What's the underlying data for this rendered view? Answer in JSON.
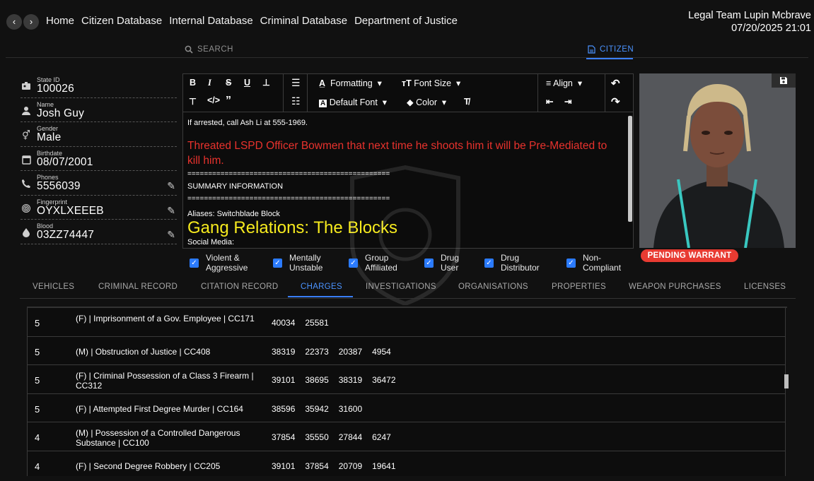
{
  "nav": {
    "back_icon": "chevron-left-icon",
    "forward_icon": "chevron-right-icon",
    "links": [
      "Home",
      "Citizen Database",
      "Internal Database",
      "Criminal Database",
      "Department of Justice"
    ]
  },
  "user": {
    "name": "Legal Team Lupin Mcbrave",
    "datetime": "07/20/2025 21:01"
  },
  "modes": {
    "search": "SEARCH",
    "citizen": "CITIZEN"
  },
  "profile": {
    "state_id": {
      "label": "State ID",
      "value": "100026"
    },
    "name": {
      "label": "Name",
      "value": "Josh Guy"
    },
    "gender": {
      "label": "Gender",
      "value": "Male"
    },
    "birthdate": {
      "label": "Birthdate",
      "value": "08/07/2001"
    },
    "phones": {
      "label": "Phones",
      "value": "5556039"
    },
    "fingerprint": {
      "label": "Fingerprint",
      "value": "OYXLXEEEB"
    },
    "blood": {
      "label": "Blood",
      "value": "03ZZ74447"
    }
  },
  "toolbar": {
    "formatting": "Formatting",
    "font_size": "Font Size",
    "default_font": "Default Font",
    "color": "Color",
    "align": "Align"
  },
  "notes": {
    "line1": "If arrested, call Ash Li at 555-1969.",
    "threat": "Threated LSPD Officer Bowmen that next time he shoots him it will be Pre-Mediated to kill him.",
    "sep": "=================================================",
    "summary": "SUMMARY INFORMATION",
    "aliases": "Aliases: Switchblade Block",
    "gang": "Gang Relations: The Blocks",
    "social": "Social Media:"
  },
  "status_badge": "PENDING WARRANT",
  "flags": [
    {
      "line1": "Violent &",
      "line2": "Aggressive",
      "checked": true
    },
    {
      "line1": "Mentally",
      "line2": "Unstable",
      "checked": true
    },
    {
      "line1": "Group",
      "line2": "Affiliated",
      "checked": true
    },
    {
      "line1": "Drug",
      "line2": "User",
      "checked": true
    },
    {
      "line1": "Drug",
      "line2": "Distributor",
      "checked": true
    },
    {
      "line1": "Non-",
      "line2": "Compliant",
      "checked": true
    }
  ],
  "tabs": [
    "VEHICLES",
    "CRIMINAL RECORD",
    "CITATION RECORD",
    "CHARGES",
    "INVESTIGATIONS",
    "ORGANISATIONS",
    "PROPERTIES",
    "WEAPON PURCHASES",
    "LICENSES"
  ],
  "active_tab": "CHARGES",
  "charges": [
    {
      "count": "5",
      "charge": "(F) | Imprisonment of a Gov. Employee | CC171",
      "refs": [
        "40034",
        "25581",
        "",
        ""
      ]
    },
    {
      "count": "5",
      "charge": "(M) | Obstruction of Justice | CC408",
      "refs": [
        "38319",
        "22373",
        "20387",
        "4954"
      ]
    },
    {
      "count": "5",
      "charge": "(F) | Criminal Possession of a Class 3 Firearm | CC312",
      "refs": [
        "39101",
        "38695",
        "38319",
        "36472"
      ]
    },
    {
      "count": "5",
      "charge": "(F) | Attempted First Degree Murder | CC164",
      "refs": [
        "38596",
        "35942",
        "31600",
        ""
      ]
    },
    {
      "count": "4",
      "charge": "(M) | Possession of a Controlled Dangerous Substance | CC100",
      "refs": [
        "37854",
        "35550",
        "27844",
        "6247"
      ]
    },
    {
      "count": "4",
      "charge": "(F) | Second Degree Robbery | CC205",
      "refs": [
        "39101",
        "37854",
        "20709",
        "19641"
      ]
    }
  ],
  "colors": {
    "accent": "#3a7fff",
    "warrant": "#e83b32",
    "threat_text": "#e8322d",
    "gang_text": "#f6ea1e"
  }
}
